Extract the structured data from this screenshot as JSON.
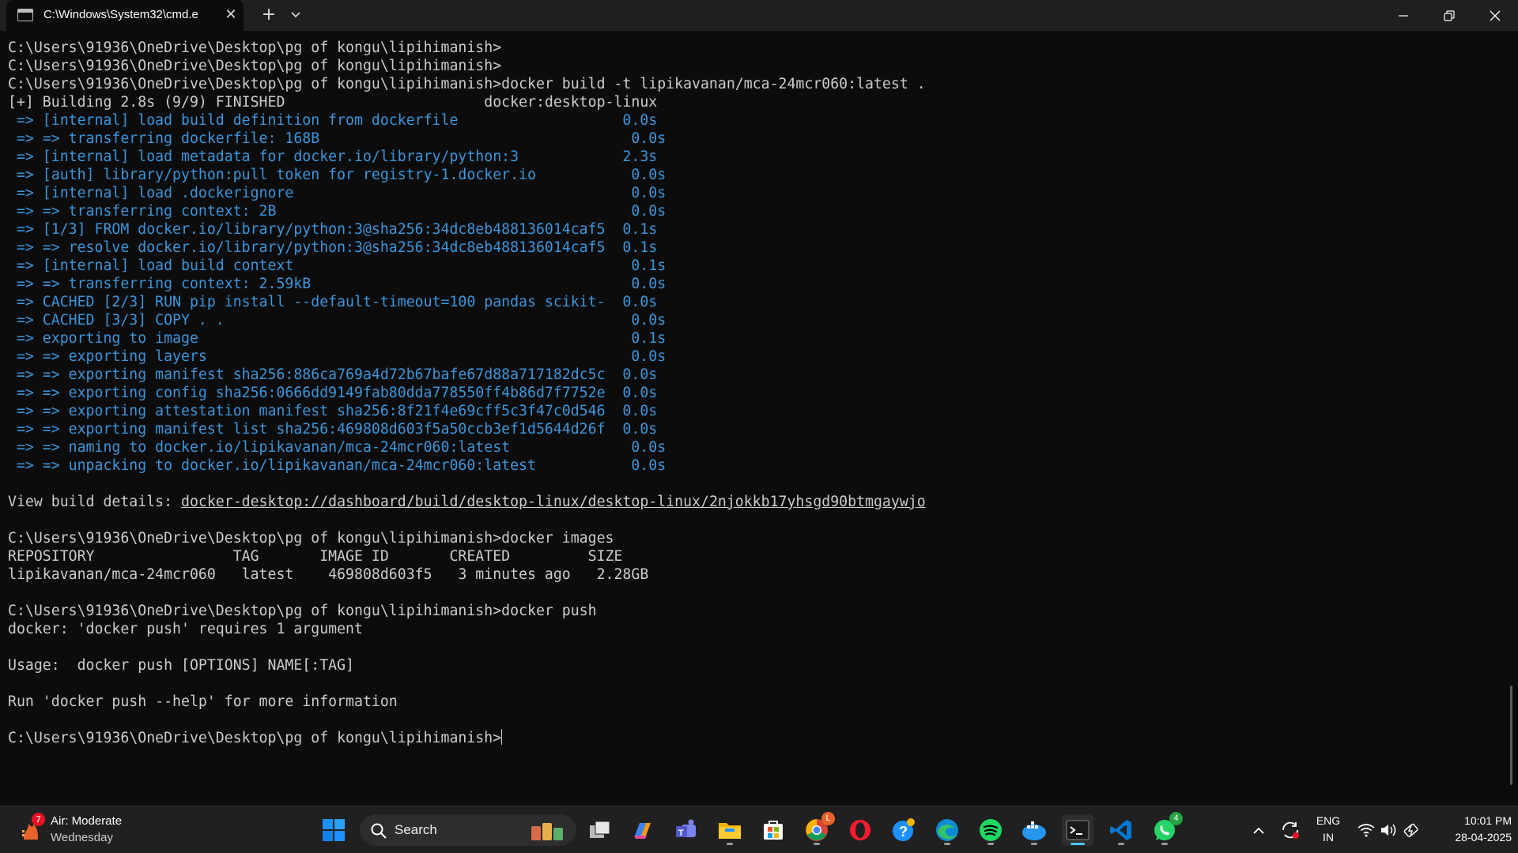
{
  "window": {
    "tab_title": "C:\\Windows\\System32\\cmd.e",
    "tab_close": "✕",
    "new_tab": "+"
  },
  "console": {
    "lines": [
      {
        "text": "C:\\Users\\91936\\OneDrive\\Desktop\\pg of kongu\\lipihimanish>",
        "color": "white"
      },
      {
        "text": "C:\\Users\\91936\\OneDrive\\Desktop\\pg of kongu\\lipihimanish>",
        "color": "white"
      },
      {
        "text": "C:\\Users\\91936\\OneDrive\\Desktop\\pg of kongu\\lipihimanish>docker build -t lipikavanan/mca-24mcr060:latest .",
        "color": "white"
      },
      {
        "text": "[+] Building 2.8s (9/9) FINISHED                       docker:desktop-linux",
        "color": "white"
      },
      {
        "text": " => [internal] load build definition from dockerfile                   0.0s",
        "color": "blue"
      },
      {
        "text": " => => transferring dockerfile: 168B                                    0.0s",
        "color": "blue"
      },
      {
        "text": " => [internal] load metadata for docker.io/library/python:3            2.3s",
        "color": "blue"
      },
      {
        "text": " => [auth] library/python:pull token for registry-1.docker.io           0.0s",
        "color": "blue"
      },
      {
        "text": " => [internal] load .dockerignore                                       0.0s",
        "color": "blue"
      },
      {
        "text": " => => transferring context: 2B                                         0.0s",
        "color": "blue"
      },
      {
        "text": " => [1/3] FROM docker.io/library/python:3@sha256:34dc8eb488136014caf5  0.1s",
        "color": "blue"
      },
      {
        "text": " => => resolve docker.io/library/python:3@sha256:34dc8eb488136014caf5  0.1s",
        "color": "blue"
      },
      {
        "text": " => [internal] load build context                                       0.1s",
        "color": "blue"
      },
      {
        "text": " => => transferring context: 2.59kB                                     0.0s",
        "color": "blue"
      },
      {
        "text": " => CACHED [2/3] RUN pip install --default-timeout=100 pandas scikit-  0.0s",
        "color": "blue"
      },
      {
        "text": " => CACHED [3/3] COPY . .                                               0.0s",
        "color": "blue"
      },
      {
        "text": " => exporting to image                                                  0.1s",
        "color": "blue"
      },
      {
        "text": " => => exporting layers                                                 0.0s",
        "color": "blue"
      },
      {
        "text": " => => exporting manifest sha256:886ca769a4d72b67bafe67d88a717182dc5c  0.0s",
        "color": "blue"
      },
      {
        "text": " => => exporting config sha256:0666dd9149fab80dda778550ff4b86d7f7752e  0.0s",
        "color": "blue"
      },
      {
        "text": " => => exporting attestation manifest sha256:8f21f4e69cff5c3f47c0d546  0.0s",
        "color": "blue"
      },
      {
        "text": " => => exporting manifest list sha256:469808d603f5a50ccb3ef1d5644d26f  0.0s",
        "color": "blue"
      },
      {
        "text": " => => naming to docker.io/lipikavanan/mca-24mcr060:latest              0.0s",
        "color": "blue"
      },
      {
        "text": " => => unpacking to docker.io/lipikavanan/mca-24mcr060:latest           0.0s",
        "color": "blue"
      },
      {
        "text": "",
        "color": "white"
      },
      {
        "text": "View build details: docker-desktop://dashboard/build/desktop-linux/desktop-linux/2njokkb17yhsgd90btmgaywjo",
        "color": "white",
        "underline_from": 20
      },
      {
        "text": "",
        "color": "white"
      },
      {
        "text": "C:\\Users\\91936\\OneDrive\\Desktop\\pg of kongu\\lipihimanish>docker images",
        "color": "white"
      },
      {
        "text": "REPOSITORY                TAG       IMAGE ID       CREATED         SIZE",
        "color": "white"
      },
      {
        "text": "lipikavanan/mca-24mcr060   latest    469808d603f5   3 minutes ago   2.28GB",
        "color": "white"
      },
      {
        "text": "",
        "color": "white"
      },
      {
        "text": "C:\\Users\\91936\\OneDrive\\Desktop\\pg of kongu\\lipihimanish>docker push",
        "color": "white"
      },
      {
        "text": "docker: 'docker push' requires 1 argument",
        "color": "white"
      },
      {
        "text": "",
        "color": "white"
      },
      {
        "text": "Usage:  docker push [OPTIONS] NAME[:TAG]",
        "color": "white"
      },
      {
        "text": "",
        "color": "white"
      },
      {
        "text": "Run 'docker push --help' for more information",
        "color": "white"
      },
      {
        "text": "",
        "color": "white"
      },
      {
        "text": "C:\\Users\\91936\\OneDrive\\Desktop\\pg of kongu\\lipihimanish>",
        "color": "white",
        "cursor": true
      }
    ]
  },
  "taskbar": {
    "weather_title": "Air: Moderate",
    "weather_subtitle": "Wednesday",
    "weather_badge": "7",
    "search_label": "Search",
    "teams_badge": "",
    "whatsapp_badge": "4",
    "language_top": "ENG",
    "language_bottom": "IN",
    "time": "10:01 PM",
    "date": "28-04-2025"
  },
  "colors": {
    "console_bg": "#0c0c0c",
    "console_text": "#cccccc",
    "console_blue": "#3a96dd",
    "titlebar_bg": "#1f1f1f",
    "taskbar_bg": "#202020",
    "accent": "#4cc2ff"
  }
}
